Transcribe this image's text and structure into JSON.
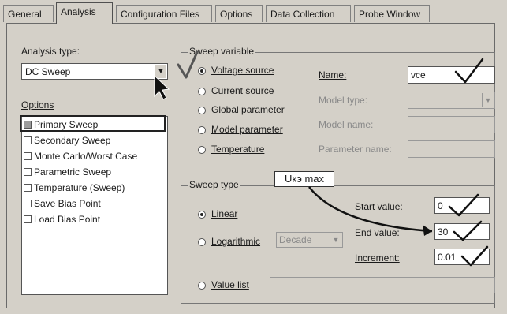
{
  "tabs": [
    "General",
    "Analysis",
    "Configuration Files",
    "Options",
    "Data Collection",
    "Probe Window"
  ],
  "active_tab": "Analysis",
  "analysis": {
    "type_label": "Analysis type:",
    "type_value": "DC Sweep",
    "options_label": "Options",
    "options": [
      {
        "label": "Primary Sweep",
        "checked": true
      },
      {
        "label": "Secondary Sweep",
        "checked": false
      },
      {
        "label": "Monte Carlo/Worst Case",
        "checked": false
      },
      {
        "label": "Parametric Sweep",
        "checked": false
      },
      {
        "label": "Temperature (Sweep)",
        "checked": false
      },
      {
        "label": "Save Bias Point",
        "checked": false
      },
      {
        "label": "Load Bias Point",
        "checked": false
      }
    ]
  },
  "sweep_variable": {
    "title": "Sweep variable",
    "radios": [
      {
        "label": "Voltage source",
        "selected": true
      },
      {
        "label": "Current source",
        "selected": false
      },
      {
        "label": "Global parameter",
        "selected": false
      },
      {
        "label": "Model parameter",
        "selected": false
      },
      {
        "label": "Temperature",
        "selected": false
      }
    ],
    "name_label": "Name:",
    "name_value": "vce",
    "model_type_label": "Model type:",
    "model_name_label": "Model name:",
    "parameter_name_label": "Parameter name:"
  },
  "sweep_type": {
    "title": "Sweep type",
    "linear_label": "Linear",
    "log_label": "Logarithmic",
    "log_option": "Decade",
    "value_list_label": "Value list",
    "start_label": "Start value:",
    "start_value": "0",
    "end_label": "End value:",
    "end_value": "30",
    "increment_label": "Increment:",
    "increment_value": "0.01",
    "selected": "Linear"
  },
  "annotation": {
    "note": "Uкэ max"
  },
  "colors": {
    "dialog": "#d4d0c8",
    "ink": "#1a1a1a"
  }
}
